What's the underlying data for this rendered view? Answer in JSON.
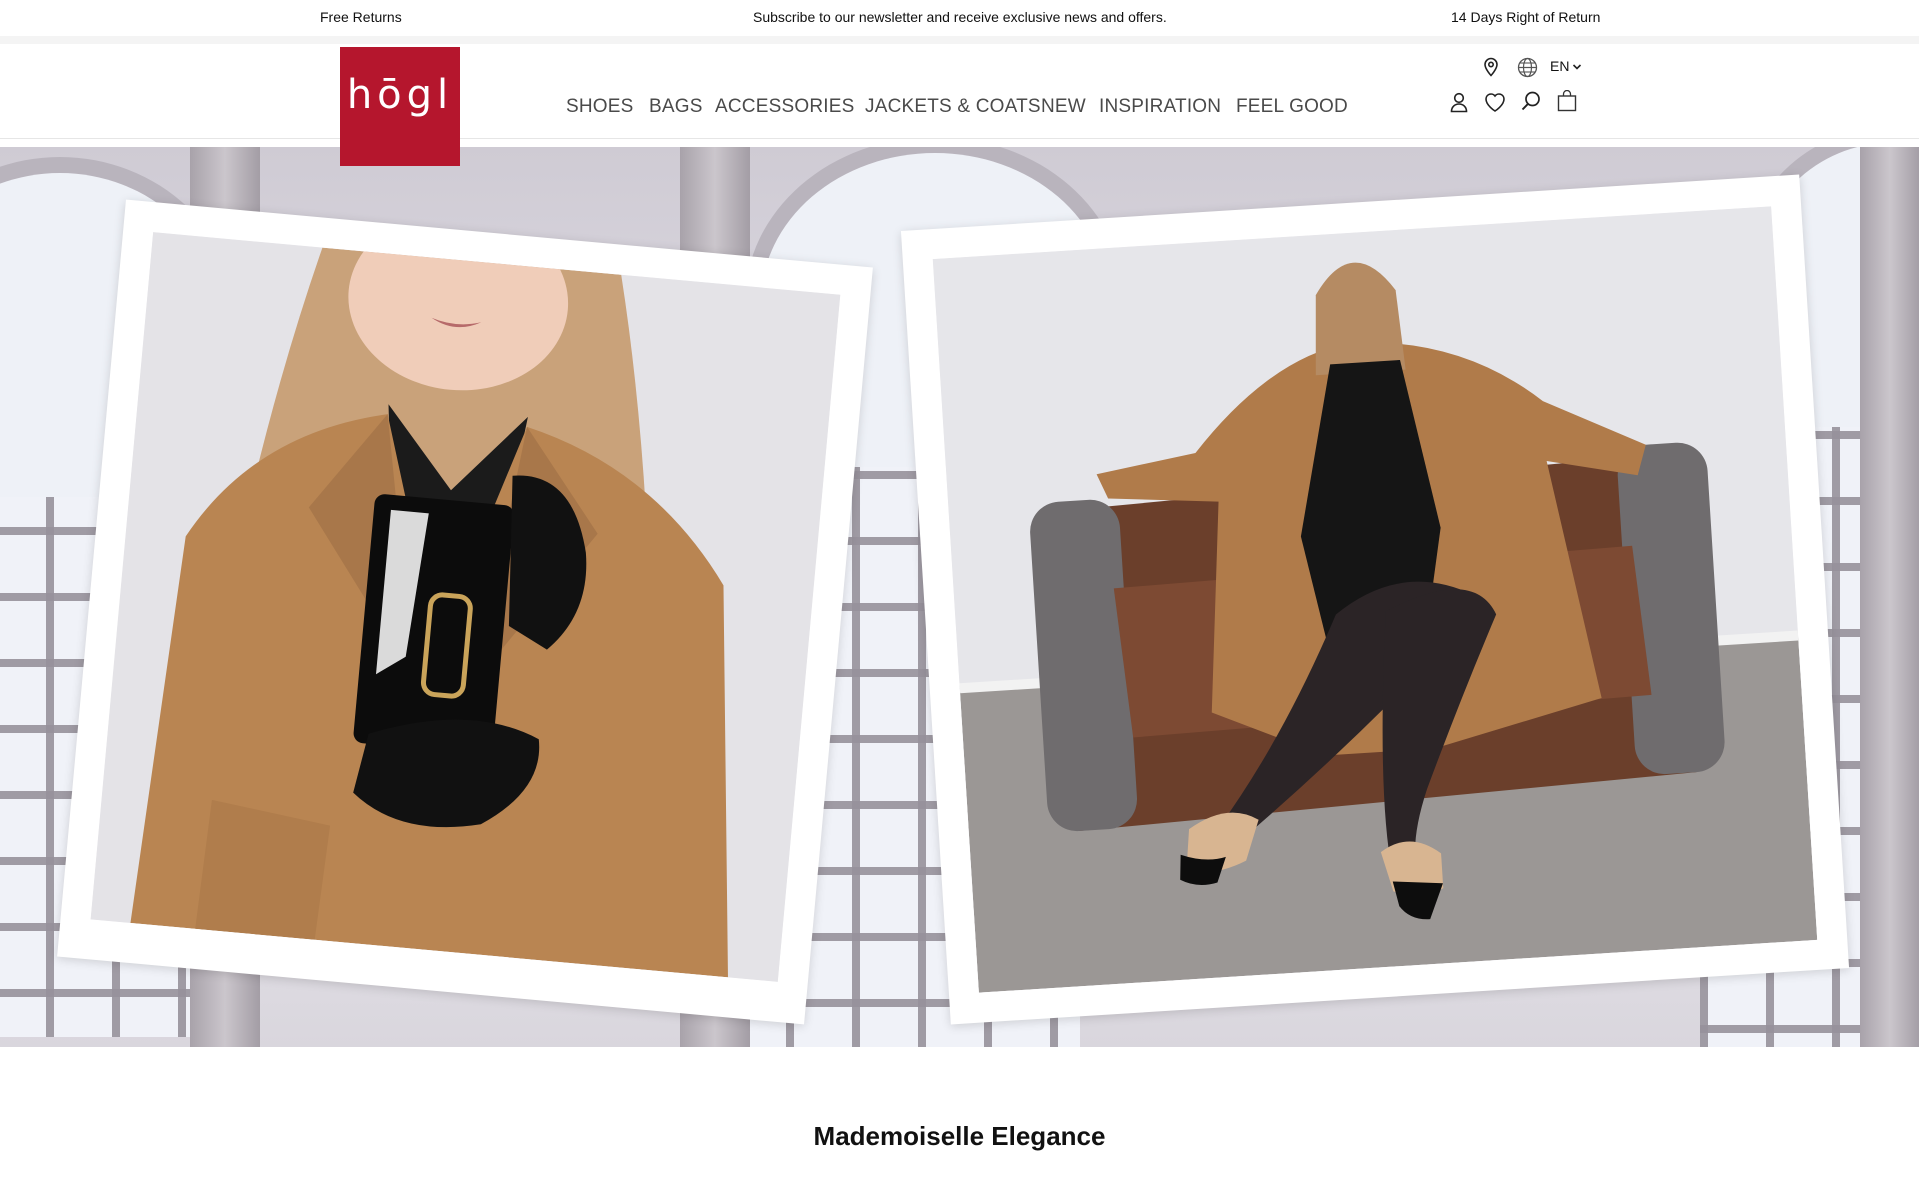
{
  "topbar": {
    "left": "Free Returns",
    "center": "Subscribe to our newsletter and receive exclusive news and offers.",
    "right": "14 Days Right of Return"
  },
  "brand": {
    "logo_text": "hōgl",
    "logo_color": "#b5162d"
  },
  "nav": {
    "items": [
      "SHOES",
      "BAGS",
      "ACCESSORIES",
      "JACKETS & COATS",
      "NEW",
      "INSPIRATION",
      "FEEL GOOD"
    ]
  },
  "utility": {
    "language": "EN",
    "icons": [
      "location-pin-icon",
      "globe-icon",
      "chevron-down-icon",
      "account-icon",
      "wishlist-heart-icon",
      "search-icon",
      "shopping-bag-icon"
    ]
  },
  "hero": {
    "images": [
      "model-with-black-handbag-photo",
      "model-seated-in-armchair-photo"
    ]
  },
  "section": {
    "headline": "Mademoiselle Elegance"
  }
}
